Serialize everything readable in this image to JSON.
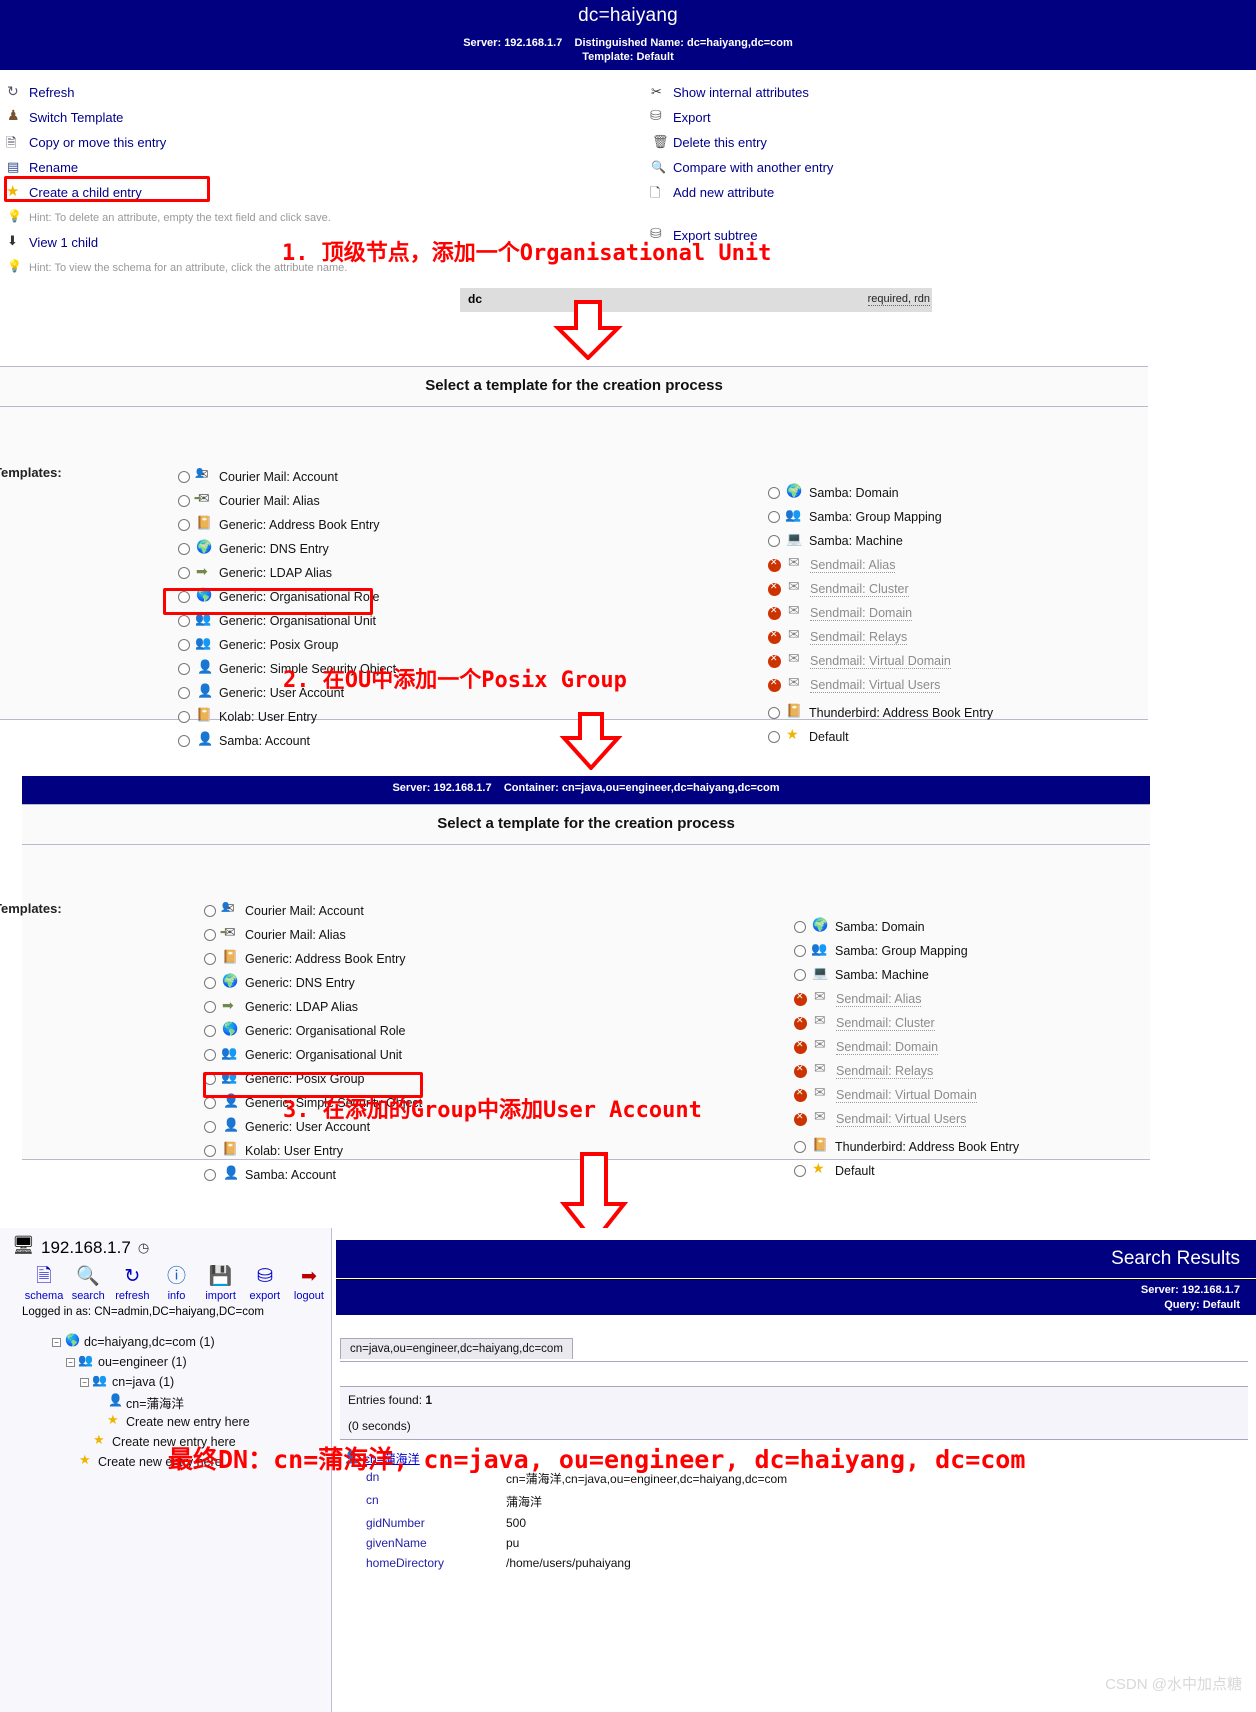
{
  "panel1": {
    "title": "dc=haiyang",
    "server_label": "Server:",
    "server_value": "192.168.1.7",
    "dn_label": "Distinguished Name:",
    "dn_value": "dc=haiyang,dc=com",
    "template_label": "Template:",
    "template_value": "Default",
    "actions_left": [
      {
        "label": "Refresh",
        "icon": "refresh-icon"
      },
      {
        "label": "Switch Template",
        "icon": "switch-template-icon"
      },
      {
        "label": "Copy or move this entry",
        "icon": "copy-icon"
      },
      {
        "label": "Rename",
        "icon": "rename-icon"
      },
      {
        "label": "Create a child entry",
        "icon": "star-icon"
      },
      {
        "label": "Hint: To delete an attribute, empty the text field and click save.",
        "icon": "lightbulb-icon"
      },
      {
        "label": "View 1 child",
        "icon": "download-arrow-icon"
      },
      {
        "label": "Hint: To view the schema for an attribute, click the attribute name.",
        "icon": "lightbulb-icon"
      }
    ],
    "actions_right": [
      {
        "label": "Show internal attributes",
        "icon": "scissors-icon"
      },
      {
        "label": "Export",
        "icon": "export-icon"
      },
      {
        "label": "Delete this entry",
        "icon": "trash-icon"
      },
      {
        "label": "Compare with another entry",
        "icon": "magnifier-icon"
      },
      {
        "label": "Add new attribute",
        "icon": "add-attribute-icon"
      },
      {
        "label": "Export subtree",
        "icon": "export-icon"
      }
    ],
    "dc_attribute": {
      "name": "dc",
      "flags": "required, rdn"
    }
  },
  "annotations": {
    "step1": "1. 顶级节点，添加一个Organisational Unit",
    "step2": "2. 在OU中添加一个Posix Group",
    "step3": "3. 在添加的Group中添加User Account",
    "step4": "最终DN：cn=蒲海洋, cn=java, ou=engineer, dc=haiyang, dc=com",
    "color": "#ff0000"
  },
  "chooser1": {
    "heading": "Select a template for the creation process",
    "templates_label": "Templates:",
    "left_items": [
      {
        "label": "Courier Mail: Account",
        "icon": "mail-account-icon",
        "state": "enabled"
      },
      {
        "label": "Courier Mail: Alias",
        "icon": "mail-alias-icon",
        "state": "enabled"
      },
      {
        "label": "Generic: Address Book Entry",
        "icon": "address-book-icon",
        "state": "enabled"
      },
      {
        "label": "Generic: DNS Entry",
        "icon": "dns-icon",
        "state": "enabled"
      },
      {
        "label": "Generic: LDAP Alias",
        "icon": "ldap-alias-icon",
        "state": "enabled"
      },
      {
        "label": "Generic: Organisational Role",
        "icon": "globe-icon",
        "state": "enabled"
      },
      {
        "label": "Generic: Organisational Unit",
        "icon": "group-icon",
        "state": "enabled"
      },
      {
        "label": "Generic: Posix Group",
        "icon": "group-icon",
        "state": "enabled"
      },
      {
        "label": "Generic: Simple Security Object",
        "icon": "user-icon",
        "state": "enabled"
      },
      {
        "label": "Generic: User Account",
        "icon": "user-icon",
        "state": "enabled"
      },
      {
        "label": "Kolab: User Entry",
        "icon": "address-book-icon",
        "state": "enabled"
      },
      {
        "label": "Samba: Account",
        "icon": "user-icon",
        "state": "enabled"
      }
    ],
    "right_items": [
      {
        "label": "Samba: Domain",
        "icon": "dns-icon",
        "state": "enabled"
      },
      {
        "label": "Samba: Group Mapping",
        "icon": "group-icon",
        "state": "enabled"
      },
      {
        "label": "Samba: Machine",
        "icon": "machine-icon",
        "state": "enabled"
      },
      {
        "label": "Sendmail: Alias",
        "icon": "mail-icon",
        "state": "disabled"
      },
      {
        "label": "Sendmail: Cluster",
        "icon": "mail-icon",
        "state": "disabled"
      },
      {
        "label": "Sendmail: Domain",
        "icon": "mail-icon",
        "state": "disabled"
      },
      {
        "label": "Sendmail: Relays",
        "icon": "mail-icon",
        "state": "disabled"
      },
      {
        "label": "Sendmail: Virtual Domain",
        "icon": "mail-icon",
        "state": "disabled"
      },
      {
        "label": "Sendmail: Virtual Users",
        "icon": "mail-icon",
        "state": "disabled"
      },
      {
        "label": "Thunderbird: Address Book Entry",
        "icon": "address-book-icon",
        "state": "enabled"
      },
      {
        "label": "Default",
        "icon": "star-icon",
        "state": "enabled"
      }
    ]
  },
  "chooser2": {
    "server_label": "Server:",
    "server_value": "192.168.1.7",
    "container_label": "Container:",
    "container_value": "cn=java,ou=engineer,dc=haiyang,dc=com",
    "heading": "Select a template for the creation process",
    "templates_label": "Templates:",
    "left_items": [
      {
        "label": "Courier Mail: Account",
        "icon": "mail-account-icon",
        "state": "enabled"
      },
      {
        "label": "Courier Mail: Alias",
        "icon": "mail-alias-icon",
        "state": "enabled"
      },
      {
        "label": "Generic: Address Book Entry",
        "icon": "address-book-icon",
        "state": "enabled"
      },
      {
        "label": "Generic: DNS Entry",
        "icon": "dns-icon",
        "state": "enabled"
      },
      {
        "label": "Generic: LDAP Alias",
        "icon": "ldap-alias-icon",
        "state": "enabled"
      },
      {
        "label": "Generic: Organisational Role",
        "icon": "globe-icon",
        "state": "enabled"
      },
      {
        "label": "Generic: Organisational Unit",
        "icon": "group-icon",
        "state": "enabled"
      },
      {
        "label": "Generic: Posix Group",
        "icon": "group-icon",
        "state": "enabled"
      },
      {
        "label": "Generic: Simple Security Object",
        "icon": "user-icon",
        "state": "enabled"
      },
      {
        "label": "Generic: User Account",
        "icon": "user-icon",
        "state": "enabled"
      },
      {
        "label": "Kolab: User Entry",
        "icon": "address-book-icon",
        "state": "enabled"
      },
      {
        "label": "Samba: Account",
        "icon": "user-icon",
        "state": "enabled"
      }
    ],
    "right_items": [
      {
        "label": "Samba: Domain",
        "icon": "dns-icon",
        "state": "enabled"
      },
      {
        "label": "Samba: Group Mapping",
        "icon": "group-icon",
        "state": "enabled"
      },
      {
        "label": "Samba: Machine",
        "icon": "machine-icon",
        "state": "enabled"
      },
      {
        "label": "Sendmail: Alias",
        "icon": "mail-icon",
        "state": "disabled"
      },
      {
        "label": "Sendmail: Cluster",
        "icon": "mail-icon",
        "state": "disabled"
      },
      {
        "label": "Sendmail: Domain",
        "icon": "mail-icon",
        "state": "disabled"
      },
      {
        "label": "Sendmail: Relays",
        "icon": "mail-icon",
        "state": "disabled"
      },
      {
        "label": "Sendmail: Virtual Domain",
        "icon": "mail-icon",
        "state": "disabled"
      },
      {
        "label": "Sendmail: Virtual Users",
        "icon": "mail-icon",
        "state": "disabled"
      },
      {
        "label": "Thunderbird: Address Book Entry",
        "icon": "address-book-icon",
        "state": "enabled"
      },
      {
        "label": "Default",
        "icon": "star-icon",
        "state": "enabled"
      }
    ]
  },
  "tree_pane": {
    "server_ip": "192.168.1.7",
    "clock_icon": "clock-icon",
    "toolbar": [
      {
        "label": "schema",
        "icon": "schema-icon"
      },
      {
        "label": "search",
        "icon": "search-icon"
      },
      {
        "label": "refresh",
        "icon": "refresh-icon"
      },
      {
        "label": "info",
        "icon": "info-icon"
      },
      {
        "label": "import",
        "icon": "import-icon"
      },
      {
        "label": "export",
        "icon": "export-icon"
      },
      {
        "label": "logout",
        "icon": "logout-icon"
      }
    ],
    "logged_in_as": "Logged in as: CN=admin,DC=haiyang,DC=com",
    "nodes": [
      {
        "label": "dc=haiyang,dc=com (1)",
        "icon": "globe-icon",
        "depth": 0,
        "expander": "−"
      },
      {
        "label": "ou=engineer (1)",
        "icon": "group-icon",
        "depth": 1,
        "expander": "−"
      },
      {
        "label": "cn=java (1)",
        "icon": "group-icon",
        "depth": 2,
        "expander": "−"
      },
      {
        "label": "cn=蒲海洋",
        "icon": "user-icon",
        "depth": 3,
        "expander": ""
      },
      {
        "label": "Create new entry here",
        "icon": "star-icon",
        "depth": 3,
        "expander": ""
      },
      {
        "label": "Create new entry here",
        "icon": "star-icon",
        "depth": 2,
        "expander": ""
      },
      {
        "label": "Create new entry here",
        "icon": "star-icon",
        "depth": 1,
        "expander": ""
      }
    ]
  },
  "results": {
    "title": "Search Results",
    "server_label": "Server:",
    "server_value": "192.168.1.7",
    "query_label": "Query:",
    "query_value": "Default",
    "base_dn_tab": "cn=java,ou=engineer,dc=haiyang,dc=com",
    "entries_found_label": "Entries found:",
    "entries_found_value": "1",
    "elapsed": "(0 seconds)",
    "entry_title": "cn=蒲海洋",
    "attributes": [
      {
        "name": "dn",
        "value": "cn=蒲海洋,cn=java,ou=engineer,dc=haiyang,dc=com"
      },
      {
        "name": "cn",
        "value": "蒲海洋"
      },
      {
        "name": "gidNumber",
        "value": "500"
      },
      {
        "name": "givenName",
        "value": "pu"
      },
      {
        "name": "homeDirectory",
        "value": "/home/users/puhaiyang"
      }
    ]
  },
  "watermark": "CSDN @水中加点糖"
}
